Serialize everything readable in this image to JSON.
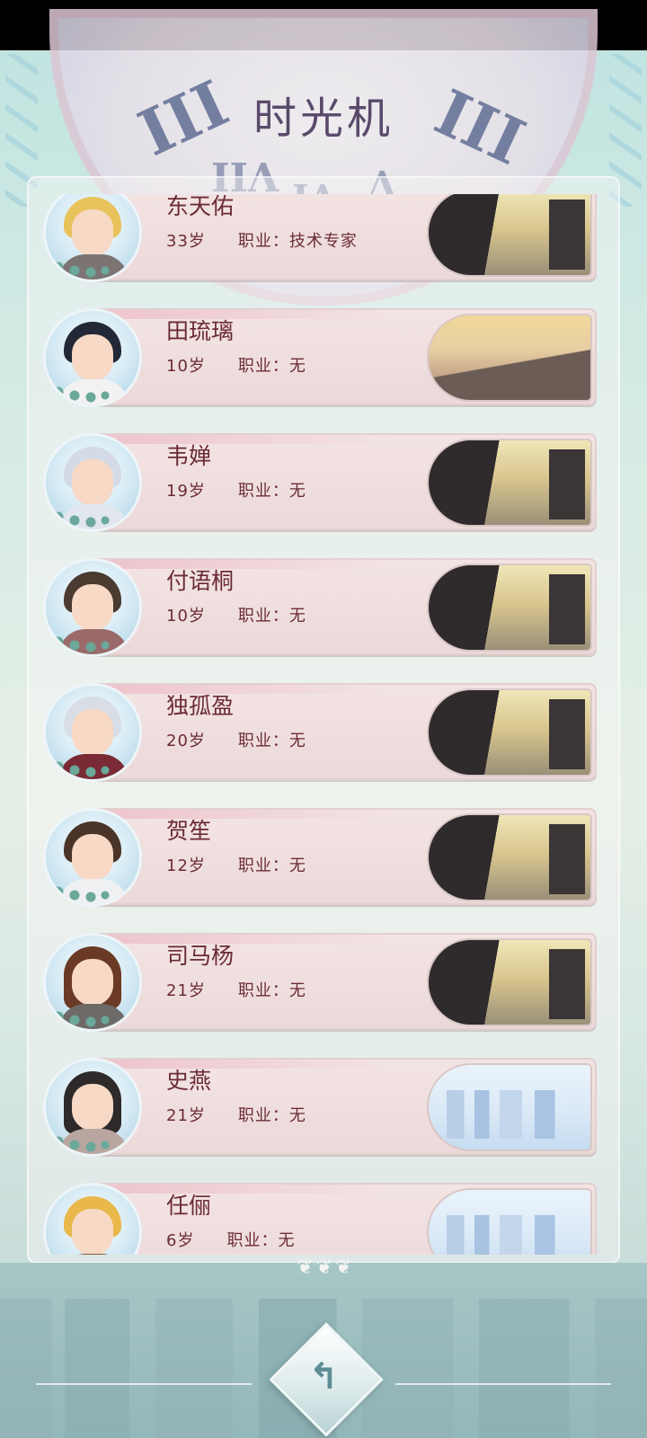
{
  "header": {
    "title": "时光机"
  },
  "characters": [
    {
      "name": "东天佑",
      "age": "33岁",
      "job": "职业：技术专家",
      "scene": "alley"
    },
    {
      "name": "田琉璃",
      "age": "10岁",
      "job": "职业：无",
      "scene": "mountain"
    },
    {
      "name": "韦婵",
      "age": "19岁",
      "job": "职业：无",
      "scene": "alley"
    },
    {
      "name": "付语桐",
      "age": "10岁",
      "job": "职业：无",
      "scene": "alley"
    },
    {
      "name": "独孤盈",
      "age": "20岁",
      "job": "职业：无",
      "scene": "alley"
    },
    {
      "name": "贺笙",
      "age": "12岁",
      "job": "职业：无",
      "scene": "alley"
    },
    {
      "name": "司马杨",
      "age": "21岁",
      "job": "职业：无",
      "scene": "alley"
    },
    {
      "name": "史燕",
      "age": "21岁",
      "job": "职业：无",
      "scene": "city"
    },
    {
      "name": "任俪",
      "age": "6岁",
      "job": "职业：无",
      "scene": "city"
    }
  ],
  "footer": {
    "back_icon": "back-arrow-icon"
  },
  "colors": {
    "name_text": "#6b2b35",
    "title_text": "#5a4a6a"
  }
}
